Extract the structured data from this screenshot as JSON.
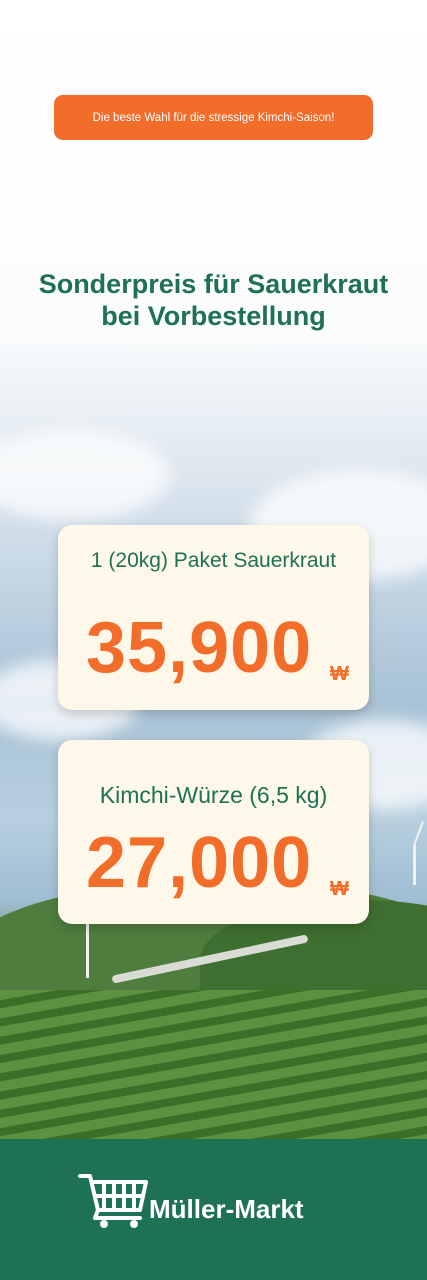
{
  "banner": {
    "text": "Die beste Wahl für die stressige Kimchi-Saison!"
  },
  "headline": {
    "line1": "Sonderpreis für Sauerkraut",
    "line2": "bei Vorbestellung"
  },
  "offers": [
    {
      "title": "1 (20kg) Paket Sauerkraut",
      "price": "35,900",
      "currency": "₩"
    },
    {
      "title": "Kimchi-Würze (6,5 kg)",
      "price": "27,000",
      "currency": "₩"
    }
  ],
  "footer": {
    "brand": "Müller-Markt",
    "icon": "shopping-cart-icon"
  },
  "colors": {
    "accent": "#f26c2a",
    "brand_green": "#1e7152",
    "card": "#fdf8ea"
  }
}
